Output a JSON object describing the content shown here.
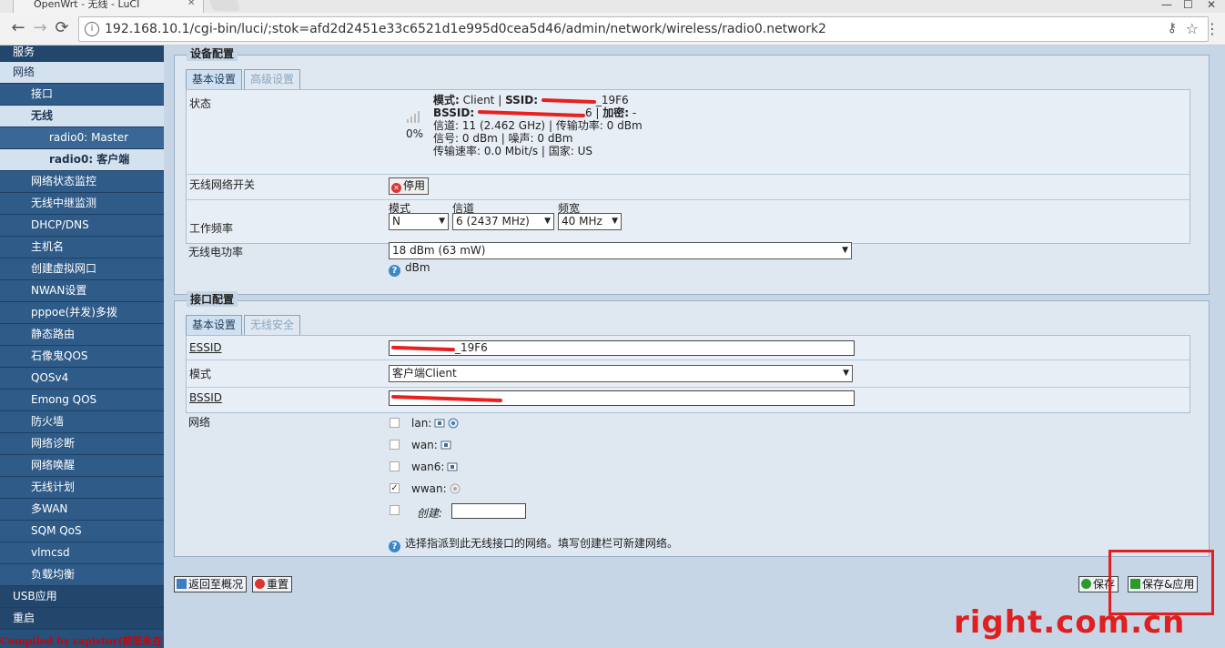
{
  "browser": {
    "tab_title": "OpenWrt - 无线 - LuCI",
    "url": "192.168.10.1/cgi-bin/luci/;stok=afd2d2451e33c6521d1e995d0cea5d46/admin/network/wireless/radio0.network2"
  },
  "sidebar": {
    "items": [
      {
        "label": "服务",
        "level": 1,
        "active": false
      },
      {
        "label": "网络",
        "level": 1,
        "active": true
      },
      {
        "label": "接口",
        "level": 2,
        "active": false
      },
      {
        "label": "无线",
        "level": 2,
        "active": true
      },
      {
        "label": "radio0: Master",
        "level": 3,
        "active": false
      },
      {
        "label": "radio0: 客户端",
        "level": 3,
        "active": true
      },
      {
        "label": "网络状态监控",
        "level": 2,
        "active": false
      },
      {
        "label": "无线中继监测",
        "level": 2,
        "active": false
      },
      {
        "label": "DHCP/DNS",
        "level": 2,
        "active": false
      },
      {
        "label": "主机名",
        "level": 2,
        "active": false
      },
      {
        "label": "创建虚拟网口",
        "level": 2,
        "active": false
      },
      {
        "label": "NWAN设置",
        "level": 2,
        "active": false
      },
      {
        "label": "pppoe(并发)多拨",
        "level": 2,
        "active": false
      },
      {
        "label": "静态路由",
        "level": 2,
        "active": false
      },
      {
        "label": "石像鬼QOS",
        "level": 2,
        "active": false
      },
      {
        "label": "QOSv4",
        "level": 2,
        "active": false
      },
      {
        "label": "Emong QOS",
        "level": 2,
        "active": false
      },
      {
        "label": "防火墙",
        "level": 2,
        "active": false
      },
      {
        "label": "网络诊断",
        "level": 2,
        "active": false
      },
      {
        "label": "网络唤醒",
        "level": 2,
        "active": false
      },
      {
        "label": "无线计划",
        "level": 2,
        "active": false
      },
      {
        "label": "多WAN",
        "level": 2,
        "active": false
      },
      {
        "label": "SQM QoS",
        "level": 2,
        "active": false
      },
      {
        "label": "vlmcsd",
        "level": 2,
        "active": false
      },
      {
        "label": "负载均衡",
        "level": 2,
        "active": false
      },
      {
        "label": "USB应用",
        "level": 1,
        "active": false
      },
      {
        "label": "重启",
        "level": 1,
        "active": false
      }
    ],
    "footer_text": "Compiled by rapistor(胡阳永在)"
  },
  "device": {
    "legend": "设备配置",
    "tabs": [
      "基本设置",
      "高级设置"
    ],
    "status_label": "状态",
    "signal_pct": "0%",
    "status": {
      "mode_k": "模式:",
      "mode_v": "Client",
      "ssid_k": "SSID:",
      "ssid_v": "_19F6",
      "bssid_k": "BSSID:",
      "bssid_v": "6",
      "enc_k": "加密:",
      "enc_v": "-",
      "channel_k": "信道:",
      "channel_v": "11 (2.462 GHz)",
      "txpower_k": "传输功率:",
      "txpower_v": "0 dBm",
      "signal_k": "信号:",
      "signal_v": "0 dBm",
      "noise_k": "噪声:",
      "noise_v": "0 dBm",
      "rate_k": "传输速率:",
      "rate_v": "0.0 Mbit/s",
      "country_k": "国家:",
      "country_v": "US"
    },
    "wireless_switch_label": "无线网络开关",
    "disable_btn": "停用",
    "freq_label": "工作频率",
    "mode_sub": "模式",
    "mode_value": "N",
    "channel_sub": "信道",
    "channel_value": "6 (2437 MHz)",
    "width_sub": "频宽",
    "width_value": "40 MHz",
    "txpower_label": "无线电功率",
    "txpower_value": "18 dBm (63 mW)",
    "txpower_unit": "dBm"
  },
  "iface": {
    "legend": "接口配置",
    "tabs": [
      "基本设置",
      "无线安全"
    ],
    "essid_label": "ESSID",
    "essid_value": "_19F6",
    "mode_label": "模式",
    "mode_value": "客户端Client",
    "bssid_label": "BSSID",
    "network_label": "网络",
    "networks": [
      {
        "name": "lan:",
        "checked": false
      },
      {
        "name": "wan:",
        "checked": false
      },
      {
        "name": "wan6:",
        "checked": false
      },
      {
        "name": "wwan:",
        "checked": true
      }
    ],
    "create_label": "创建:",
    "help_text": "选择指派到此无线接口的网络。填写创建栏可新建网络。"
  },
  "footer": {
    "back_btn": "返回至概况",
    "reset_btn": "重置",
    "save_btn": "保存",
    "save_apply_btn": "保存&应用"
  },
  "watermark": "right.com.cn",
  "colors": {
    "sidebar_bg": "#27507a",
    "active_item_bg": "#d4e1ee",
    "panel_bg": "#dfe8f1",
    "annotation_red": "#e02020"
  }
}
